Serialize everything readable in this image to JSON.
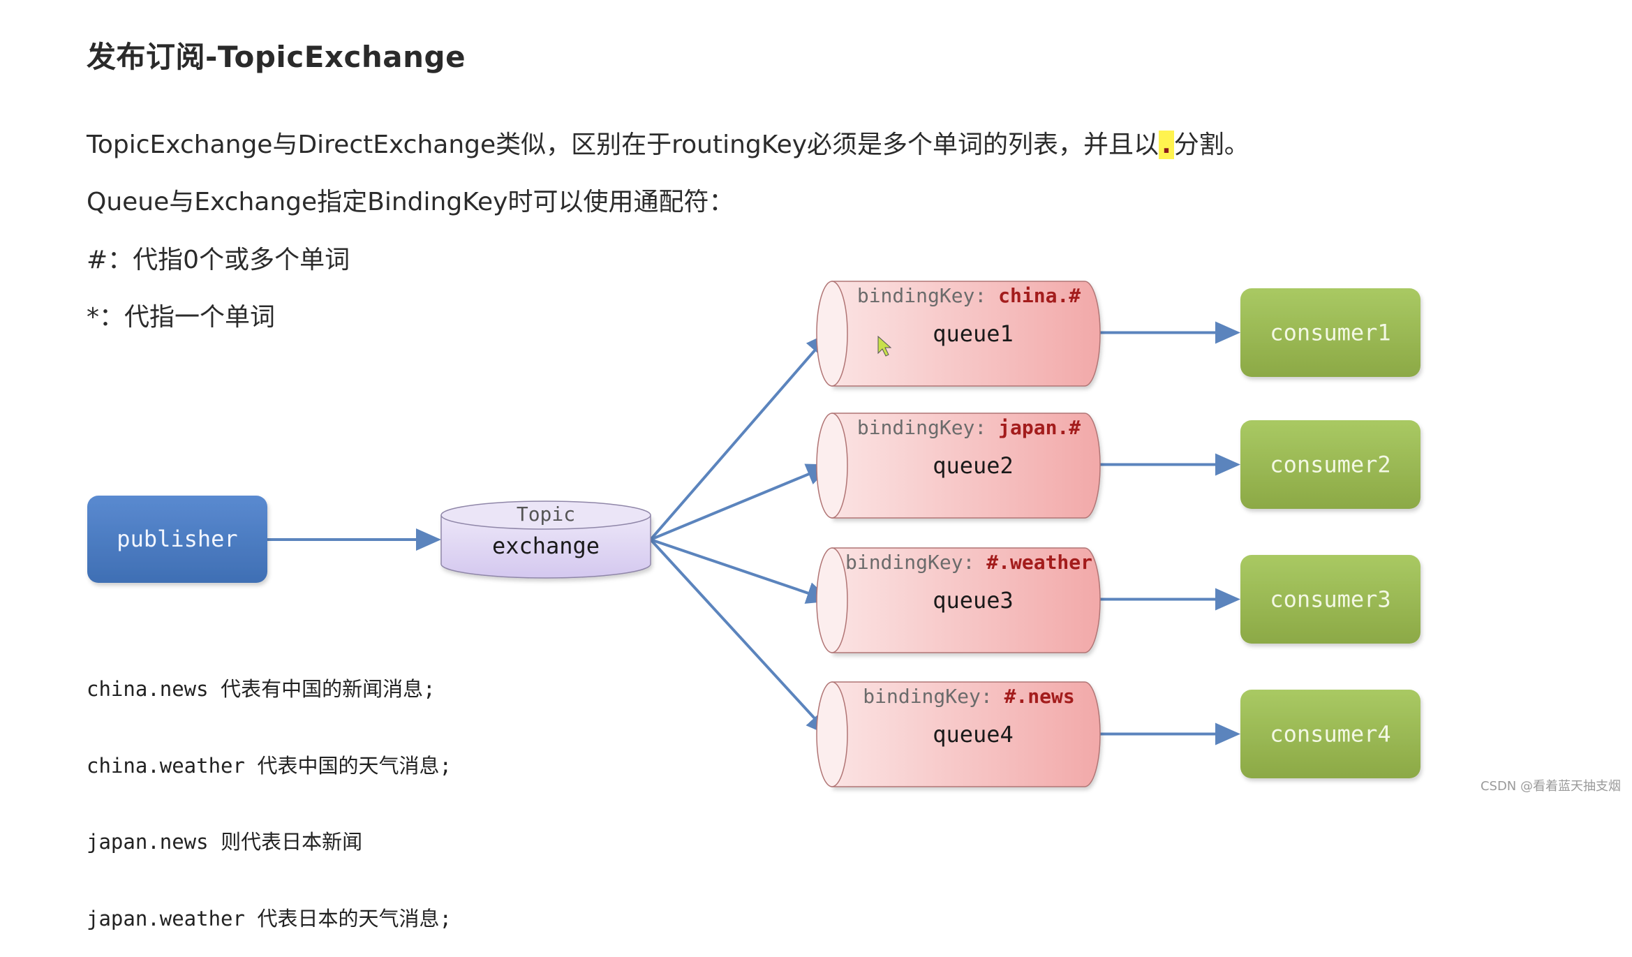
{
  "title": "发布订阅-TopicExchange",
  "description": {
    "line1_before": "TopicExchange与DirectExchange类似，区别在于routingKey必须是多个单词的列表，并且以",
    "line1_highlight": ".",
    "line1_after": "分割。",
    "line2": "Queue与Exchange指定BindingKey时可以使用通配符：",
    "line3": "#：代指0个或多个单词",
    "line4": "*：代指一个单词"
  },
  "diagram": {
    "publisher": {
      "label": "publisher",
      "color": "#4a7cc2"
    },
    "exchange": {
      "type_label": "Topic",
      "label": "exchange",
      "color": "#ddd3f1"
    },
    "binding_key_prefix": "bindingKey: ",
    "queues": [
      {
        "label": "queue1",
        "binding_key": "china.#"
      },
      {
        "label": "queue2",
        "binding_key": "japan.#"
      },
      {
        "label": "queue3",
        "binding_key": "#.weather"
      },
      {
        "label": "queue4",
        "binding_key": "#.news"
      }
    ],
    "consumers": [
      {
        "label": "consumer1"
      },
      {
        "label": "consumer2"
      },
      {
        "label": "consumer3"
      },
      {
        "label": "consumer4"
      }
    ],
    "colors": {
      "arrow": "#5b84bd",
      "queue_fill": "#f5b8b8",
      "binding_key_value": "#a31c1c",
      "consumer_fill": "#9aba4e"
    }
  },
  "routing_examples": [
    {
      "key": "china.news",
      "meaning": "代表有中国的新闻消息;"
    },
    {
      "key": "china.weather",
      "meaning": "代表中国的天气消息;"
    },
    {
      "key": "japan.news",
      "meaning": "则代表日本新闻"
    },
    {
      "key": "japan.weather",
      "meaning": "代表日本的天气消息;"
    }
  ],
  "watermark": "CSDN @看着蓝天抽支烟"
}
